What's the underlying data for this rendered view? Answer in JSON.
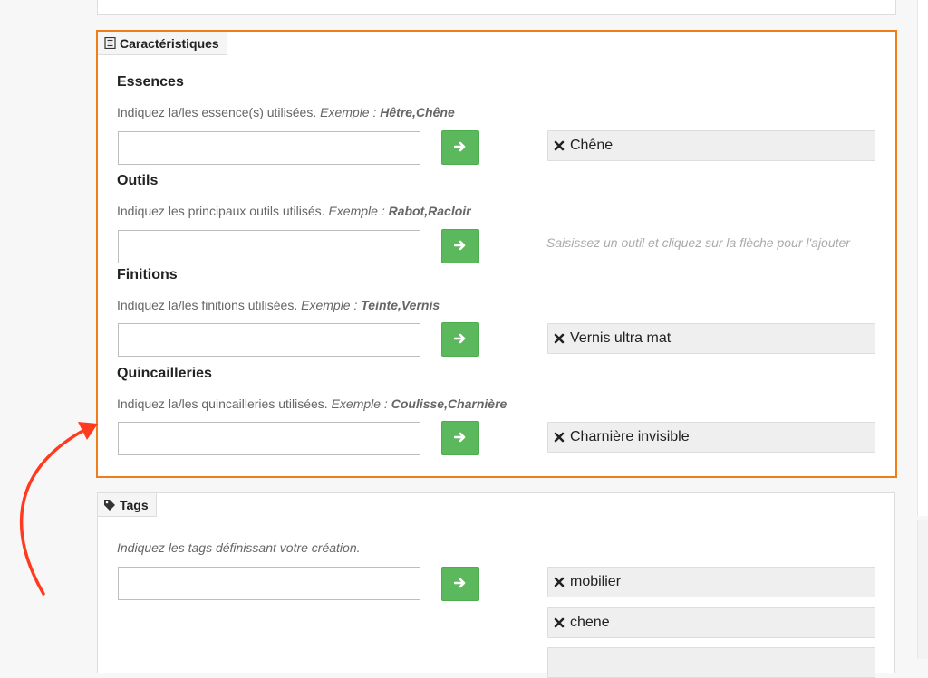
{
  "caracteristiques": {
    "tab_label": "Caractéristiques",
    "tab_icon": "document-list-icon",
    "fields": [
      {
        "title": "Essences",
        "help_text": "Indiquez la/les essence(s) utilisées.",
        "example_label": "Exemple :",
        "example_value": "Hêtre,Chêne",
        "input_value": "",
        "tags": [
          "Chêne"
        ]
      },
      {
        "title": "Outils",
        "help_text": "Indiquez les principaux outils utilisés.",
        "example_label": "Exemple :",
        "example_value": "Rabot,Racloir",
        "input_value": "",
        "hint": "Saisissez un outil et cliquez sur la flèche pour l'ajouter"
      },
      {
        "title": "Finitions",
        "help_text": "Indiquez la/les finitions utilisées.",
        "example_label": "Exemple :",
        "example_value": "Teinte,Vernis",
        "input_value": "",
        "tags": [
          "Vernis ultra mat"
        ]
      },
      {
        "title": "Quincailleries",
        "help_text": "Indiquez la/les quincailleries utilisées.",
        "example_label": "Exemple :",
        "example_value": "Coulisse,Charnière",
        "input_value": "",
        "tags": [
          "Charnière invisible"
        ]
      }
    ]
  },
  "tags_section": {
    "tab_label": "Tags",
    "tab_icon": "tag-icon",
    "help_text": "Indiquez les tags définissant votre création.",
    "input_value": "",
    "tags": [
      "mobilier",
      "chene"
    ]
  },
  "colors": {
    "highlight_border": "#f07d1a",
    "add_button": "#5cb85c",
    "annotation_arrow": "#ff3b1f"
  }
}
